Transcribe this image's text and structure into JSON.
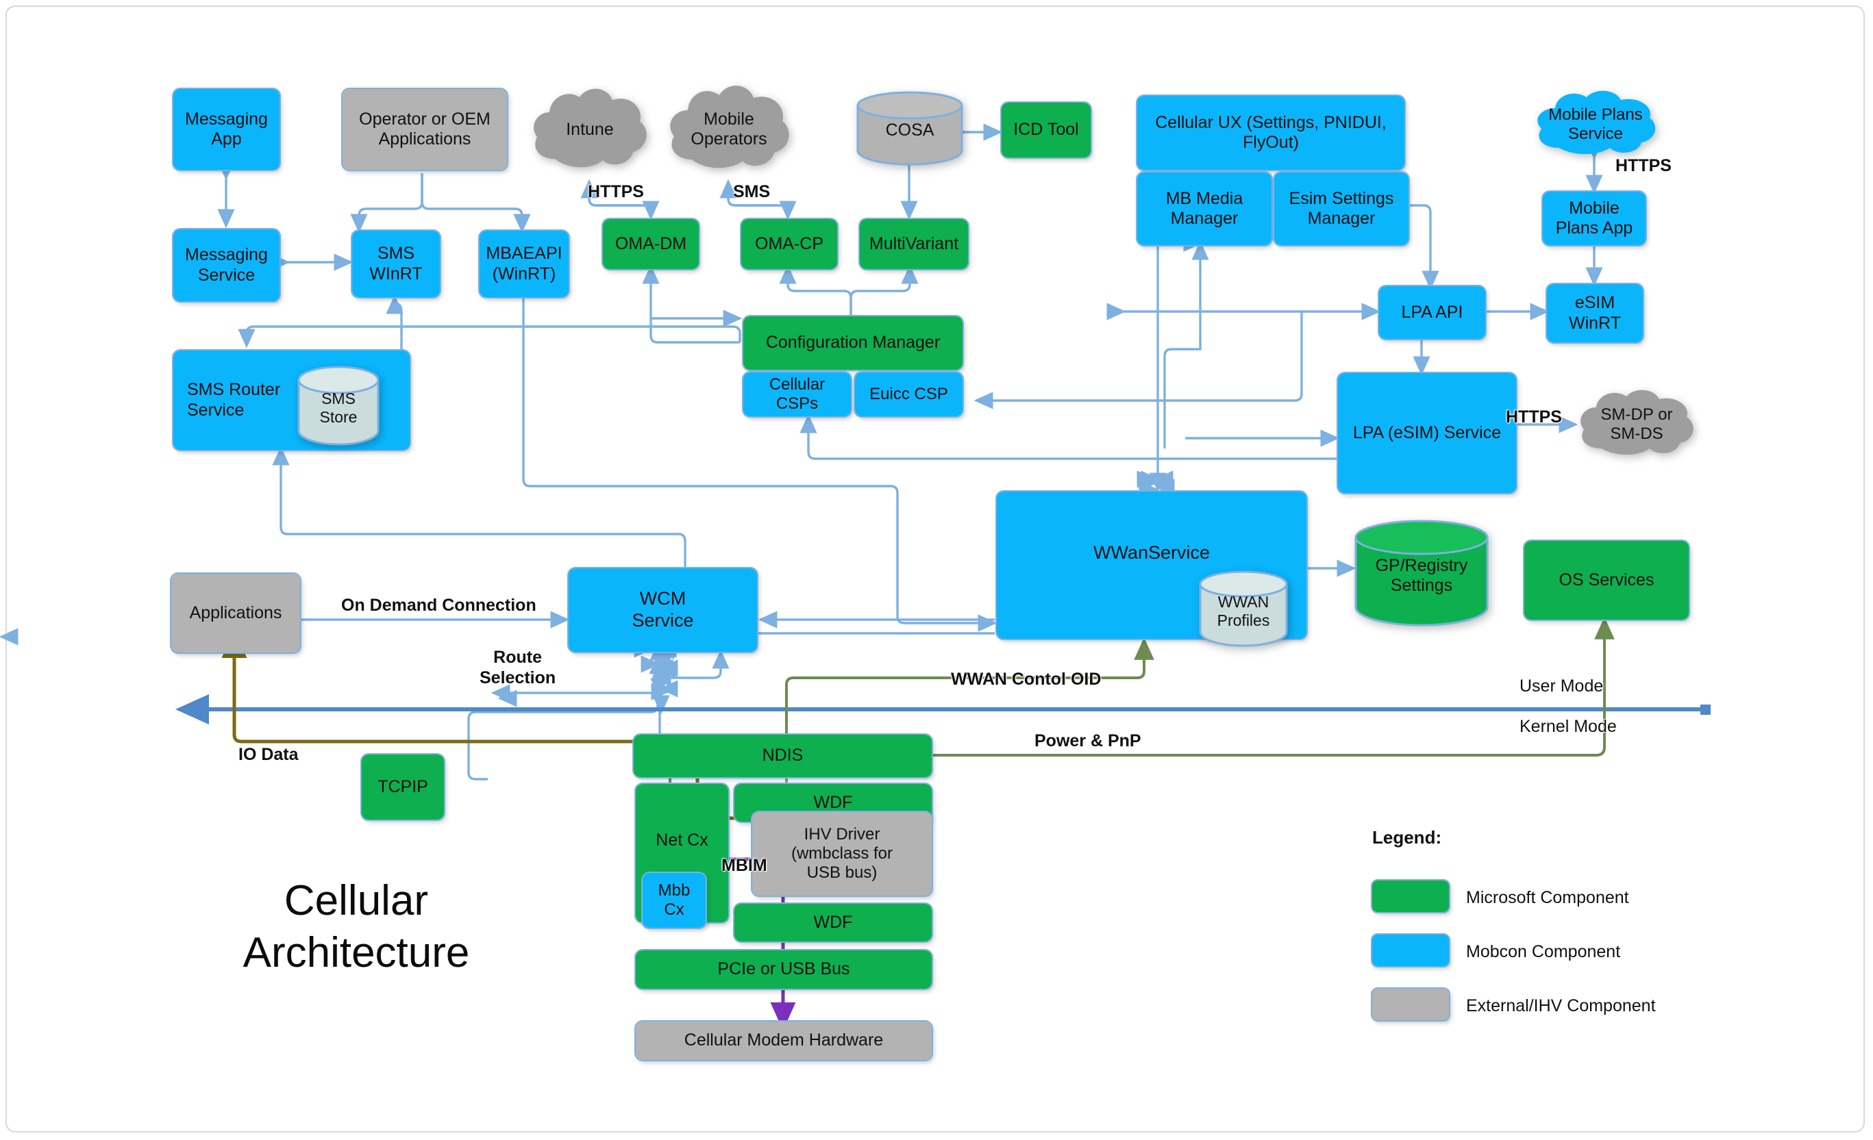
{
  "diagram": {
    "title_line1": "Cellular",
    "title_line2": "Architecture",
    "colors": {
      "microsoft": "#0DAF4F",
      "mobcon": "#0BB5FC",
      "external": "#B3B3B3",
      "connector": "#7EB0E0",
      "mode_divider": "#4E89C9",
      "io_data_flow": "#7C6B10",
      "control_flow": "#6E8B52",
      "mbim_flow": "#7B2FBE"
    }
  },
  "nodes": {
    "messaging_app": "Messaging\nApp",
    "messaging_service": "Messaging\nService",
    "operator_oem_applications": "Operator or OEM\nApplications",
    "sms_winrt": "SMS\nWInRT",
    "mbaeapi_winrt": "MBAEAPI\n(WinRT)",
    "sms_router_service": "SMS Router\nService",
    "sms_store": "SMS\nStore",
    "intune": "Intune",
    "mobile_operators": "Mobile\nOperators",
    "oma_dm": "OMA-DM",
    "oma_cp": "OMA-CP",
    "multivariant": "MultiVariant",
    "cosa": "COSA",
    "icd_tool": "ICD Tool",
    "configuration_manager": "Configuration Manager",
    "cellular_csps": "Cellular CSPs",
    "euicc_csp": "Euicc CSP",
    "cellular_ux": "Cellular UX (Settings, PNIDUI,\nFlyOut)",
    "mb_media_manager": "MB Media\nManager",
    "esim_settings_manager": "Esim Settings\nManager",
    "lpa_api": "LPA API",
    "lpa_esim_service": "LPA (eSIM) Service",
    "mobile_plans_service": "Mobile Plans\nService",
    "mobile_plans_app": "Mobile\nPlans App",
    "esim_winrt": "eSIM\nWinRT",
    "sm_dp_or_sm_ds": "SM-DP or\nSM-DS",
    "wwanservice": "WWanService",
    "wwan_profiles": "WWAN\nProfiles",
    "gp_registry_settings": "GP/Registry\nSettings",
    "os_services": "OS Services",
    "applications": "Applications",
    "wcm_service": "WCM\nService",
    "tcpip": "TCPIP",
    "ndis": "NDIS",
    "netcx": "Net Cx",
    "mbb_cx": "Mbb\nCx",
    "wdf_top": "WDF",
    "wdf_bottom": "WDF",
    "ihv_driver": "IHV Driver\n(wmbclass for\nUSB bus)",
    "pcie_or_usb_bus": "PCIe or USB Bus",
    "cellular_modem_hardware": "Cellular Modem Hardware"
  },
  "edge_labels": {
    "https_intune": "HTTPS",
    "sms_operators": "SMS",
    "https_mobile_plans": "HTTPS",
    "https_smdp": "HTTPS",
    "on_demand_connection": "On Demand Connection",
    "route_selection": "Route\nSelection",
    "io_data": "IO Data",
    "wwan_control_oid": "WWAN Contol OID",
    "power_and_pnp": "Power & PnP",
    "user_mode": "User Mode",
    "kernel_mode": "Kernel Mode",
    "mbim": "MBIM"
  },
  "legend": {
    "heading": "Legend:",
    "items": [
      {
        "label": "Microsoft Component",
        "color": "#0DAF4F"
      },
      {
        "label": "Mobcon Component",
        "color": "#0BB5FC"
      },
      {
        "label": "External/IHV Component",
        "color": "#B3B3B3"
      }
    ]
  }
}
